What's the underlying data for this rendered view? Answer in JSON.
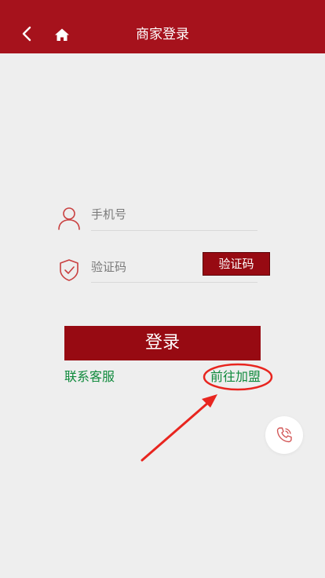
{
  "header": {
    "title": "商家登录",
    "back_icon": "chevron-left-icon",
    "home_icon": "home-icon"
  },
  "form": {
    "phone_placeholder": "手机号",
    "phone_icon": "user-icon",
    "code_placeholder": "验证码",
    "code_icon": "shield-check-icon",
    "get_code_label": "验证码",
    "login_label": "登录"
  },
  "links": {
    "contact_service": "联系客服",
    "join": "前往加盟"
  },
  "floating": {
    "phone_icon": "phone-icon"
  },
  "colors": {
    "header_bg": "#a6121c",
    "button_bg": "#970a12",
    "link": "#0f8a3c",
    "annotation": "#e8251f",
    "page_bg": "#eeeeee"
  }
}
